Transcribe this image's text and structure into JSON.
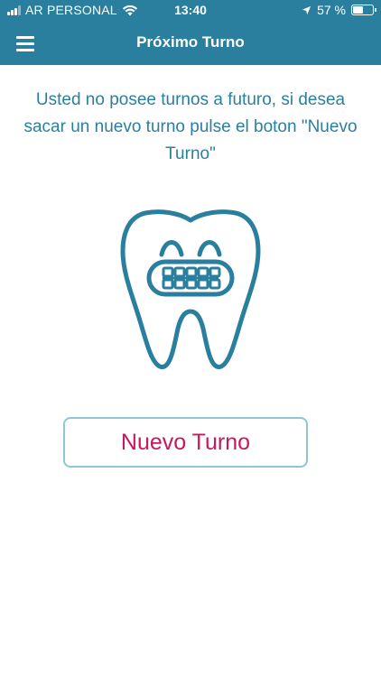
{
  "status_bar": {
    "carrier": "AR PERSONAL",
    "time": "13:40",
    "battery_text": "57 %",
    "battery_level": 0.57
  },
  "nav": {
    "title": "Próximo Turno",
    "menu_icon": "hamburger-menu-icon"
  },
  "main": {
    "message": "Usted no posee turnos a futuro, si desea sacar un nuevo turno pulse el boton \"Nuevo Turno\"",
    "illustration_icon": "tooth-with-braces-icon",
    "new_button_label": "Nuevo Turno"
  },
  "colors": {
    "primary": "#2b7f9e",
    "button_text": "#c8185f",
    "button_border": "#8fc6d6"
  }
}
